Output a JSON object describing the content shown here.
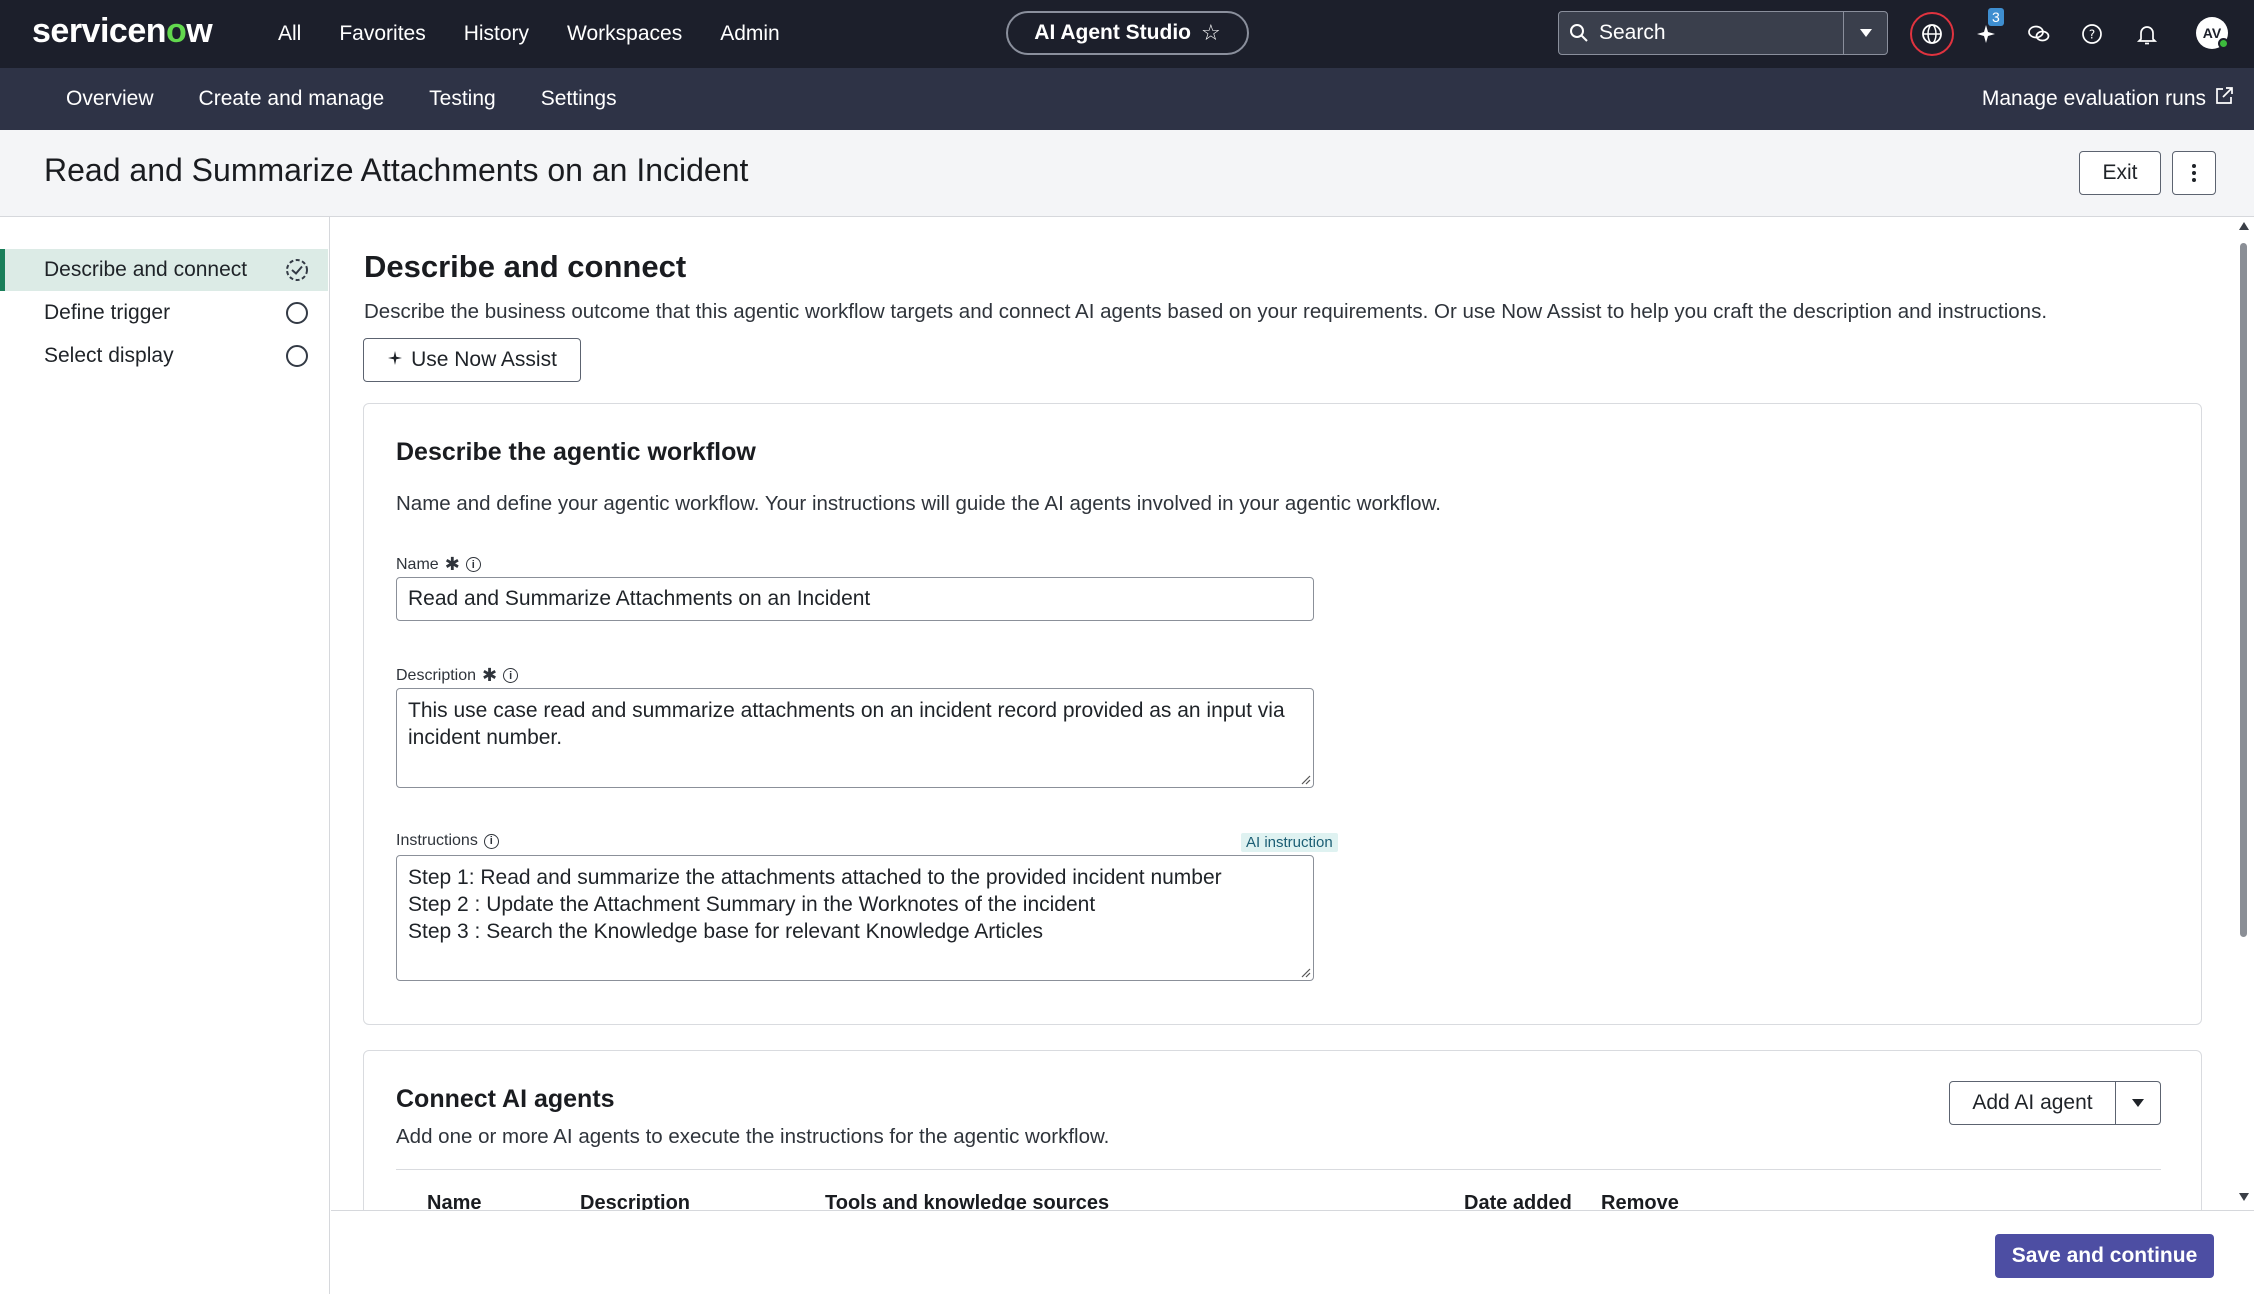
{
  "brand": {
    "logo_text_pre": "servicen",
    "logo_text_o": "o",
    "logo_text_post": "w",
    "accent": "#62d84e"
  },
  "topnav": {
    "items": [
      "All",
      "Favorites",
      "History",
      "Workspaces",
      "Admin"
    ]
  },
  "studio": {
    "label": "AI Agent Studio"
  },
  "search": {
    "label": "Search"
  },
  "toolbar": {
    "notification_count": "3",
    "avatar_initials": "AV"
  },
  "subnav": {
    "items": [
      "Overview",
      "Create and manage",
      "Testing",
      "Settings"
    ],
    "manage_label": "Manage evaluation runs"
  },
  "page": {
    "title": "Read and Summarize Attachments on an Incident",
    "exit_label": "Exit"
  },
  "steps": {
    "items": [
      {
        "label": "Describe and connect",
        "active": true
      },
      {
        "label": "Define trigger",
        "active": false
      },
      {
        "label": "Select display",
        "active": false
      }
    ]
  },
  "main": {
    "heading": "Describe and connect",
    "lead": "Describe the business outcome that this agentic workflow targets and connect AI agents based on your requirements. Or use Now Assist to help you craft the description and instructions.",
    "assist_label": "Use Now Assist"
  },
  "workflow": {
    "heading": "Describe the agentic workflow",
    "subtext": "Name and define your agentic workflow. Your instructions will guide the AI agents involved in your agentic workflow.",
    "name_label": "Name",
    "name_value": "Read and Summarize Attachments on an Incident",
    "description_label": "Description",
    "description_value": "This use case read and summarize attachments on an incident record provided as an input via incident number.",
    "instructions_label": "Instructions",
    "ai_tag": "AI instruction",
    "instructions_lines": [
      "Step 1: Read and summarize the attachments attached to the provided incident number",
      "Step 2 : Update the Attachment Summary in the Worknotes of the incident",
      "Step 3 : Search the Knowledge base for relevant Knowledge Articles"
    ]
  },
  "agents": {
    "heading": "Connect AI agents",
    "subtext": "Add one or more AI agents to execute the instructions for the agentic workflow.",
    "add_label": "Add AI agent",
    "columns": [
      "Name",
      "Description",
      "Tools and knowledge sources",
      "Date added",
      "Remove"
    ]
  },
  "footer": {
    "save_label": "Save and continue",
    "save_color": "#4d4ea3"
  }
}
